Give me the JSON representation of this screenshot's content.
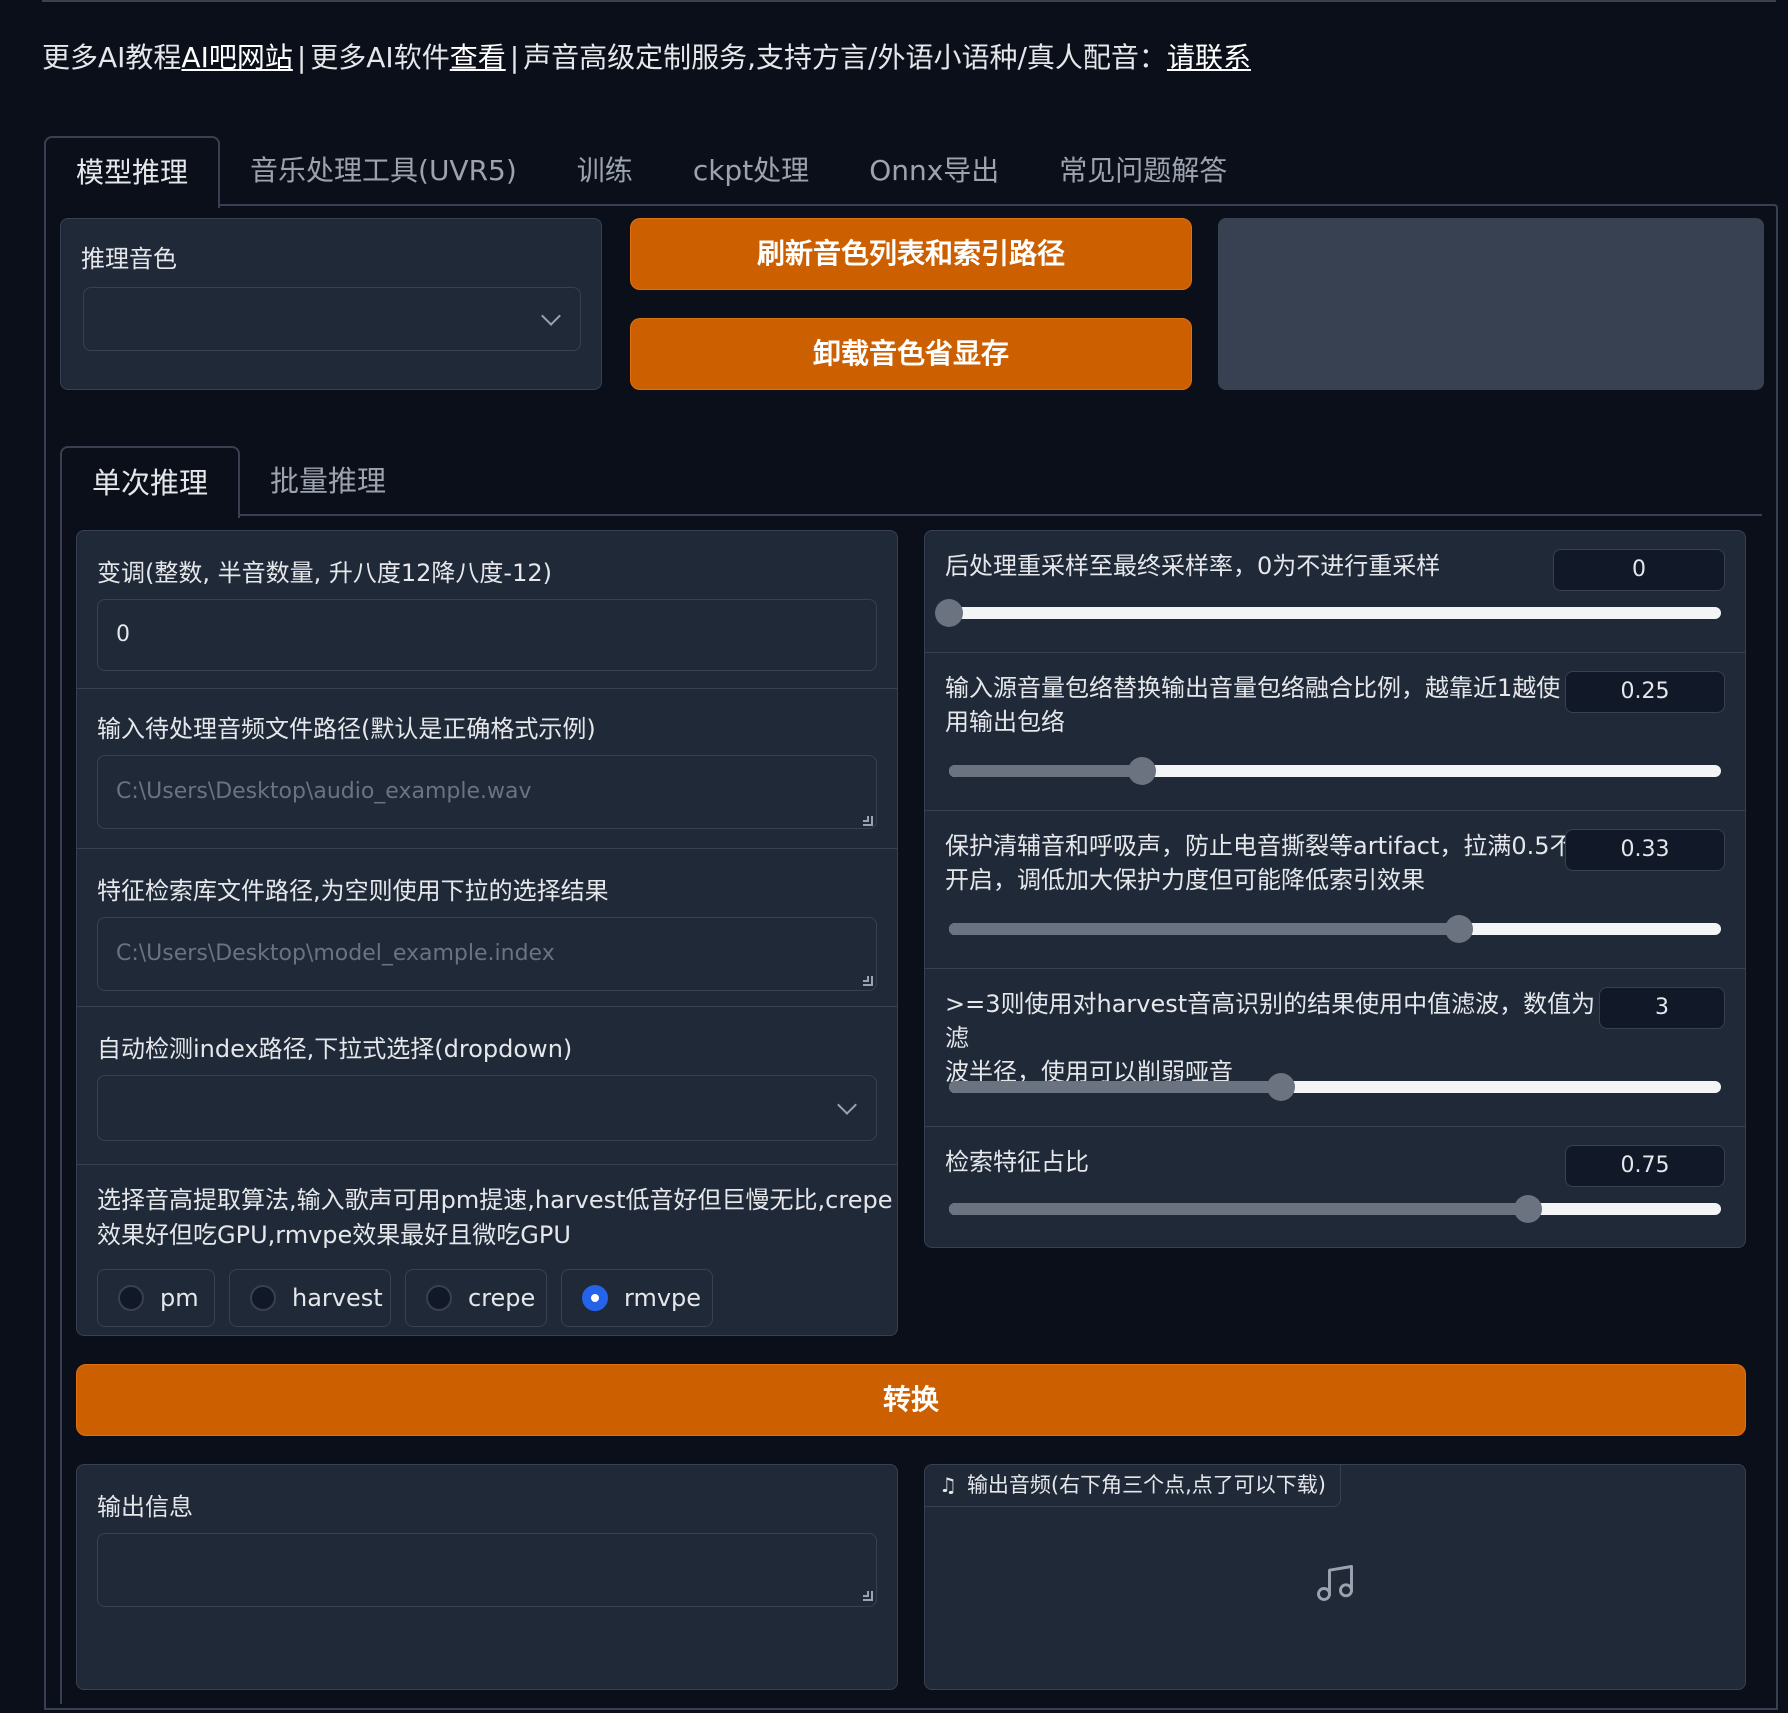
{
  "header": {
    "part1": "更多AI教程",
    "link1": "AI吧网站",
    "sep1": "|",
    "part2": "更多AI软件",
    "link2": "查看",
    "sep2": "|",
    "part3": "声音高级定制服务,支持方言/外语小语种/真人配音：",
    "link3": "请联系"
  },
  "main_tabs": [
    {
      "label": "模型推理",
      "active": true
    },
    {
      "label": "音乐处理工具(UVR5)"
    },
    {
      "label": "训练"
    },
    {
      "label": "ckpt处理"
    },
    {
      "label": "Onnx导出"
    },
    {
      "label": "常见问题解答"
    }
  ],
  "voice": {
    "label": "推理音色",
    "value": ""
  },
  "buttons": {
    "refresh": "刷新音色列表和索引路径",
    "unload": "卸载音色省显存",
    "convert": "转换"
  },
  "sub_tabs": [
    {
      "label": "单次推理",
      "active": true
    },
    {
      "label": "批量推理"
    }
  ],
  "left": {
    "transpose": {
      "label": "变调(整数, 半音数量, 升八度12降八度-12)",
      "value": "0"
    },
    "input_path": {
      "label": "输入待处理音频文件路径(默认是正确格式示例)",
      "placeholder": "C:\\Users\\Desktop\\audio_example.wav"
    },
    "index_path": {
      "label": "特征检索库文件路径,为空则使用下拉的选择结果",
      "placeholder": "C:\\Users\\Desktop\\model_example.index"
    },
    "auto_index": {
      "label": "自动检测index路径,下拉式选择(dropdown)",
      "value": ""
    },
    "f0": {
      "label_line1": "选择音高提取算法,输入歌声可用pm提速,harvest低音好但巨慢无比,crepe",
      "label_line2": "效果好但吃GPU,rmvpe效果最好且微吃GPU",
      "options": [
        "pm",
        "harvest",
        "crepe",
        "rmvpe"
      ],
      "selected": "rmvpe"
    }
  },
  "right": {
    "resample": {
      "label": "后处理重采样至最终采样率，0为不进行重采样",
      "value": "0",
      "fraction": 0.0
    },
    "rms_mix": {
      "label_line1": "输入源音量包络替换输出音量包络融合比例，越靠近1越使",
      "label_line2": "用输出包络",
      "value": "0.25",
      "fraction": 0.25
    },
    "protect": {
      "label_line1": "保护清辅音和呼吸声，防止电音撕裂等artifact，拉满0.5不",
      "label_line2": "开启，调低加大保护力度但可能降低索引效果",
      "value": "0.33",
      "fraction": 0.66
    },
    "filter_radius": {
      "label_line1": ">=3则使用对harvest音高识别的结果使用中值滤波，数值为滤",
      "label_line2": "波半径，使用可以削弱哑音",
      "value": "3",
      "fraction": 0.43
    },
    "index_rate": {
      "label": "检索特征占比",
      "value": "0.75",
      "fraction": 0.75
    }
  },
  "output": {
    "info_label": "输出信息",
    "info_value": "",
    "audio_label": "输出音频(右下角三个点,点了可以下载)"
  },
  "colors": {
    "accent": "#cc5f00",
    "background": "#0b0f19",
    "block": "#1f2937",
    "border": "#374151",
    "radio_selected": "#2563eb"
  }
}
